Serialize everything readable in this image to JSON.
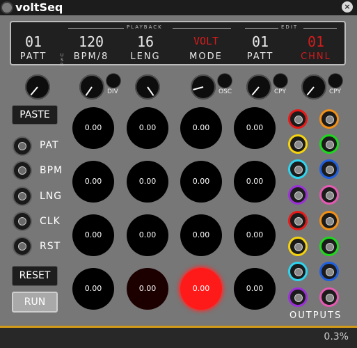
{
  "window": {
    "title": "voltSeq",
    "close_glyph": "×"
  },
  "display": {
    "playback_label": "PLAYBACK",
    "edit_label": "EDIT",
    "usr": [
      "U",
      "S",
      "R"
    ],
    "fields": [
      {
        "value": "01",
        "label": "PATT",
        "color": "#e8e8e8"
      },
      {
        "value": "120",
        "label": "BPM/8",
        "color": "#e8e8e8"
      },
      {
        "value": "16",
        "label": "LENG",
        "color": "#e8e8e8"
      },
      {
        "value": "VOLT",
        "label": "MODE",
        "color": "#e8e8e8",
        "value_color": "#d41c1c"
      },
      {
        "value": "01",
        "label": "PATT",
        "color": "#e8e8e8"
      },
      {
        "value": "01",
        "label": "CHNL",
        "color": "#d41c1c"
      }
    ]
  },
  "knob_labels": {
    "div": "DIV",
    "osc": "OSC",
    "cpy1": "CPY",
    "cpy2": "CPY"
  },
  "buttons": {
    "paste": "PASTE",
    "reset": "RESET",
    "run": "RUN"
  },
  "inputs": [
    "PAT",
    "BPM",
    "LNG",
    "CLK",
    "RST"
  ],
  "steps": [
    [
      "0.00",
      "0.00",
      "0.00",
      "0.00"
    ],
    [
      "0.00",
      "0.00",
      "0.00",
      "0.00"
    ],
    [
      "0.00",
      "0.00",
      "0.00",
      "0.00"
    ],
    [
      "0.00",
      "0.00",
      "0.00",
      "0.00"
    ]
  ],
  "active_step": {
    "row": 3,
    "col": 2,
    "color": "#ff1a1a"
  },
  "dim_step": {
    "row": 3,
    "col": 1,
    "color": "#1c0000"
  },
  "outputs_label": "OUTPUTS",
  "output_ring_colors": [
    [
      "#e81818",
      "#f39016"
    ],
    [
      "#f5d30e",
      "#1ed81e"
    ],
    [
      "#2fd4ef",
      "#1f5fe0"
    ],
    [
      "#9b2fd8",
      "#e65ab4"
    ],
    [
      "#e81818",
      "#f39016"
    ],
    [
      "#f5d30e",
      "#1ed81e"
    ],
    [
      "#2fd4ef",
      "#1f5fe0"
    ],
    [
      "#9b2fd8",
      "#e65ab4"
    ]
  ],
  "status": "0.3%"
}
